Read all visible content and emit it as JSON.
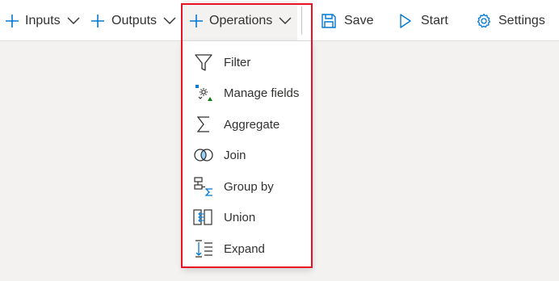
{
  "toolbar": {
    "inputs_label": "Inputs",
    "outputs_label": "Outputs",
    "operations_label": "Operations",
    "save_label": "Save",
    "start_label": "Start",
    "settings_label": "Settings"
  },
  "operations_menu": {
    "items": [
      {
        "label": "Filter",
        "icon": "filter-icon"
      },
      {
        "label": "Manage fields",
        "icon": "manage-fields-icon"
      },
      {
        "label": "Aggregate",
        "icon": "sigma-icon"
      },
      {
        "label": "Join",
        "icon": "join-icon"
      },
      {
        "label": "Group by",
        "icon": "group-by-icon"
      },
      {
        "label": "Union",
        "icon": "union-icon"
      },
      {
        "label": "Expand",
        "icon": "expand-icon"
      }
    ]
  },
  "colors": {
    "accent": "#0078d4",
    "highlight_border": "#e81123",
    "icon_green": "#107c10"
  }
}
